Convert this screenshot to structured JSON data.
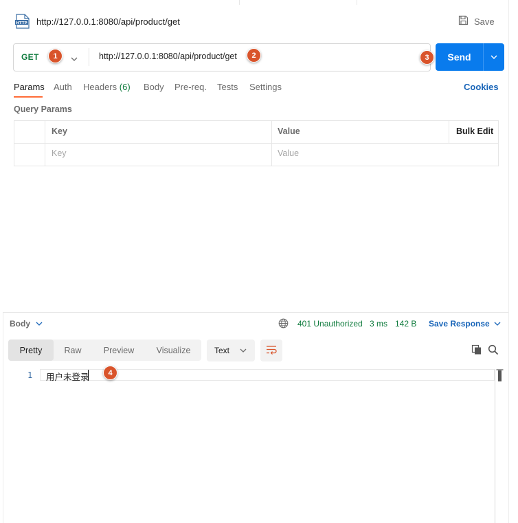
{
  "request": {
    "icon": "http-file-icon",
    "title": "http://127.0.0.1:8080/api/product/get",
    "save_label": "Save",
    "method": "GET",
    "url": "http://127.0.0.1:8080/api/product/get",
    "send_label": "Send"
  },
  "annotations": [
    "1",
    "2",
    "3",
    "4"
  ],
  "tabs": {
    "params": "Params",
    "auth": "Auth",
    "headers": "Headers",
    "headers_count": "(6)",
    "body": "Body",
    "prereq": "Pre-req.",
    "tests": "Tests",
    "settings": "Settings",
    "cookies": "Cookies"
  },
  "query_params": {
    "title": "Query Params",
    "col_key": "Key",
    "col_value": "Value",
    "bulk_edit": "Bulk Edit",
    "key_placeholder": "Key",
    "value_placeholder": "Value"
  },
  "response": {
    "section_label": "Body",
    "status": "401 Unauthorized",
    "time": "3 ms",
    "size": "142 B",
    "save_response": "Save Response",
    "views": [
      "Pretty",
      "Raw",
      "Preview",
      "Visualize"
    ],
    "format": "Text",
    "line_number": "1",
    "body_text": "用户未登录"
  },
  "colors": {
    "accent": "#097bed",
    "method_green": "#0f7b3d",
    "tab_indicator": "#ff6c37",
    "annotation": "#d9542b",
    "link": "#1a66b9"
  }
}
